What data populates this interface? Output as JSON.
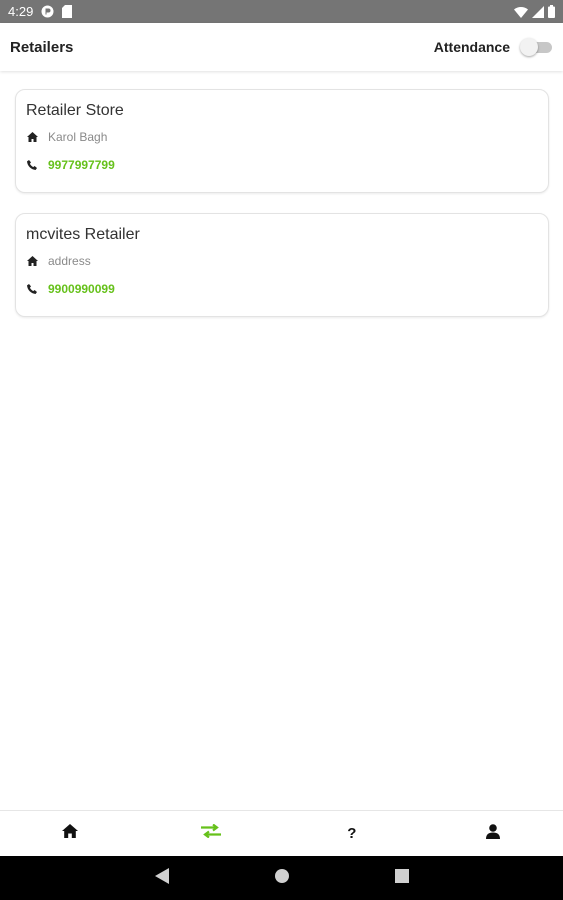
{
  "status_bar": {
    "time": "4:29",
    "icons": [
      "notification-icon",
      "sd-card-icon",
      "wifi-icon",
      "signal-icon",
      "battery-icon"
    ]
  },
  "header": {
    "title": "Retailers",
    "attendance_label": "Attendance",
    "attendance_on": false
  },
  "retailers": [
    {
      "name": "Retailer Store",
      "address": "Karol Bagh",
      "phone": "9977997799"
    },
    {
      "name": "mcvites Retailer",
      "address": "address",
      "phone": "9900990099"
    }
  ],
  "bottom_nav": {
    "items": [
      {
        "icon": "home-icon",
        "active": false
      },
      {
        "icon": "transfer-icon",
        "active": true
      },
      {
        "icon": "help-icon",
        "label": "?",
        "active": false
      },
      {
        "icon": "user-icon",
        "active": false
      }
    ]
  },
  "system_nav": [
    "back-icon",
    "home-circle-icon",
    "recents-icon"
  ],
  "colors": {
    "accent": "#66c11b",
    "status_bar": "#757575",
    "system_nav": "#000000"
  }
}
